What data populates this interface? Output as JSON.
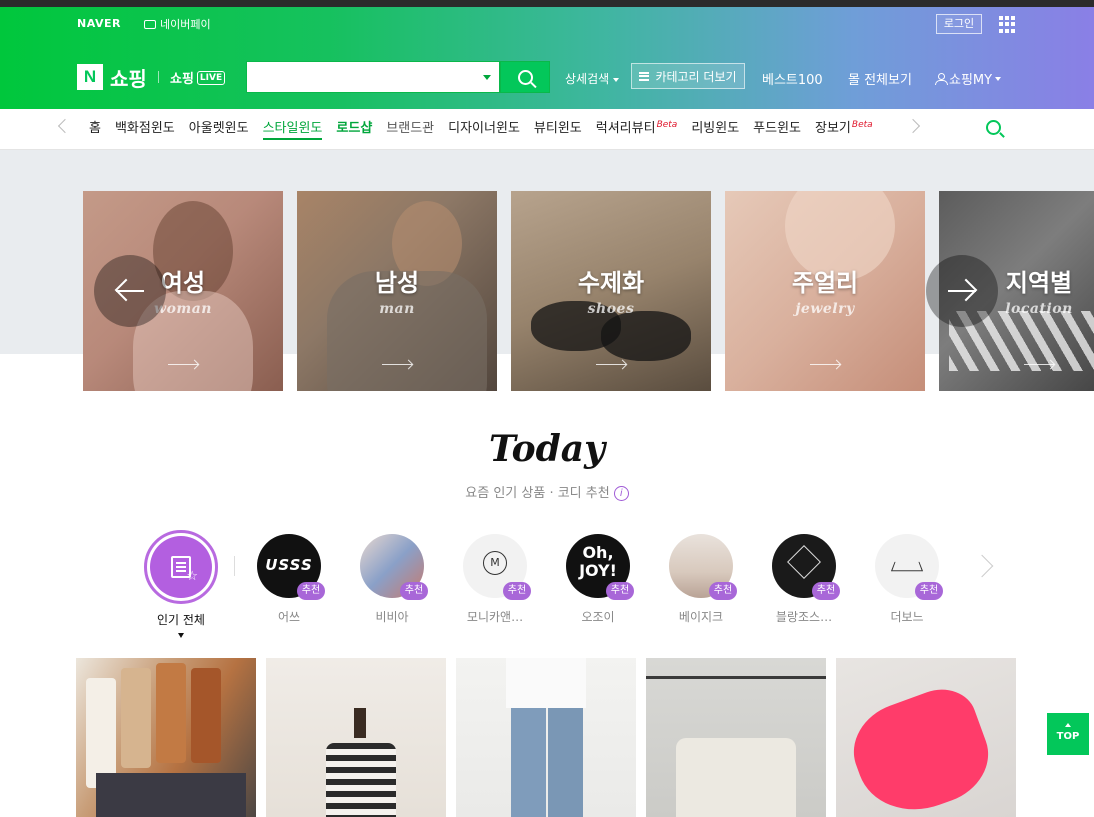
{
  "gnb": {
    "naver": "NAVER",
    "pay": "네이버페이",
    "login": "로그인"
  },
  "header": {
    "logo_letter": "N",
    "shopping": "쇼핑",
    "live_prefix": "쇼핑",
    "live_badge": "LIVE",
    "search_placeholder": "",
    "detail_search": "상세검색",
    "category_more": "카테고리 더보기",
    "best100": "베스트100",
    "mall_all": "몰 전체보기",
    "shop_my": "쇼핑MY"
  },
  "tabs": [
    {
      "label": "홈"
    },
    {
      "label": "백화점윈도"
    },
    {
      "label": "아울렛윈도"
    },
    {
      "label": "스타일윈도"
    },
    {
      "label": "로드샵"
    },
    {
      "label": "브랜드관"
    },
    {
      "label": "디자이너윈도"
    },
    {
      "label": "뷰티윈도"
    },
    {
      "label": "럭셔리뷰티",
      "badge": "Beta"
    },
    {
      "label": "리빙윈도"
    },
    {
      "label": "푸드윈도"
    },
    {
      "label": "장보기",
      "badge": "Beta"
    }
  ],
  "banners": [
    {
      "title": "여성",
      "sub": "woman"
    },
    {
      "title": "남성",
      "sub": "man"
    },
    {
      "title": "수제화",
      "sub": "shoes"
    },
    {
      "title": "주얼리",
      "sub": "jewelry"
    },
    {
      "title": "지역별",
      "sub": "location"
    }
  ],
  "today": {
    "title": "Today",
    "subtitle": "요즘 인기 상품 · 코디 추천",
    "info": "i"
  },
  "stores": {
    "all_label": "인기 전체",
    "badge": "추천",
    "items": [
      {
        "name": "어쓰",
        "logo": "USSS",
        "color": "#111111"
      },
      {
        "name": "비비아",
        "logo": "",
        "color": "#8aa0c8"
      },
      {
        "name": "모니카앤…",
        "logo": "M",
        "color": "#f2f2f2"
      },
      {
        "name": "오조이",
        "logo": "Oh, JOY!",
        "color": "#111111"
      },
      {
        "name": "베이지크",
        "logo": "",
        "color": "#d8c9bd"
      },
      {
        "name": "블랑조스…",
        "logo": "",
        "color": "#1a1a1a"
      },
      {
        "name": "더보느",
        "logo": "",
        "color": "#f2f2f2"
      }
    ]
  },
  "top_button": "TOP"
}
